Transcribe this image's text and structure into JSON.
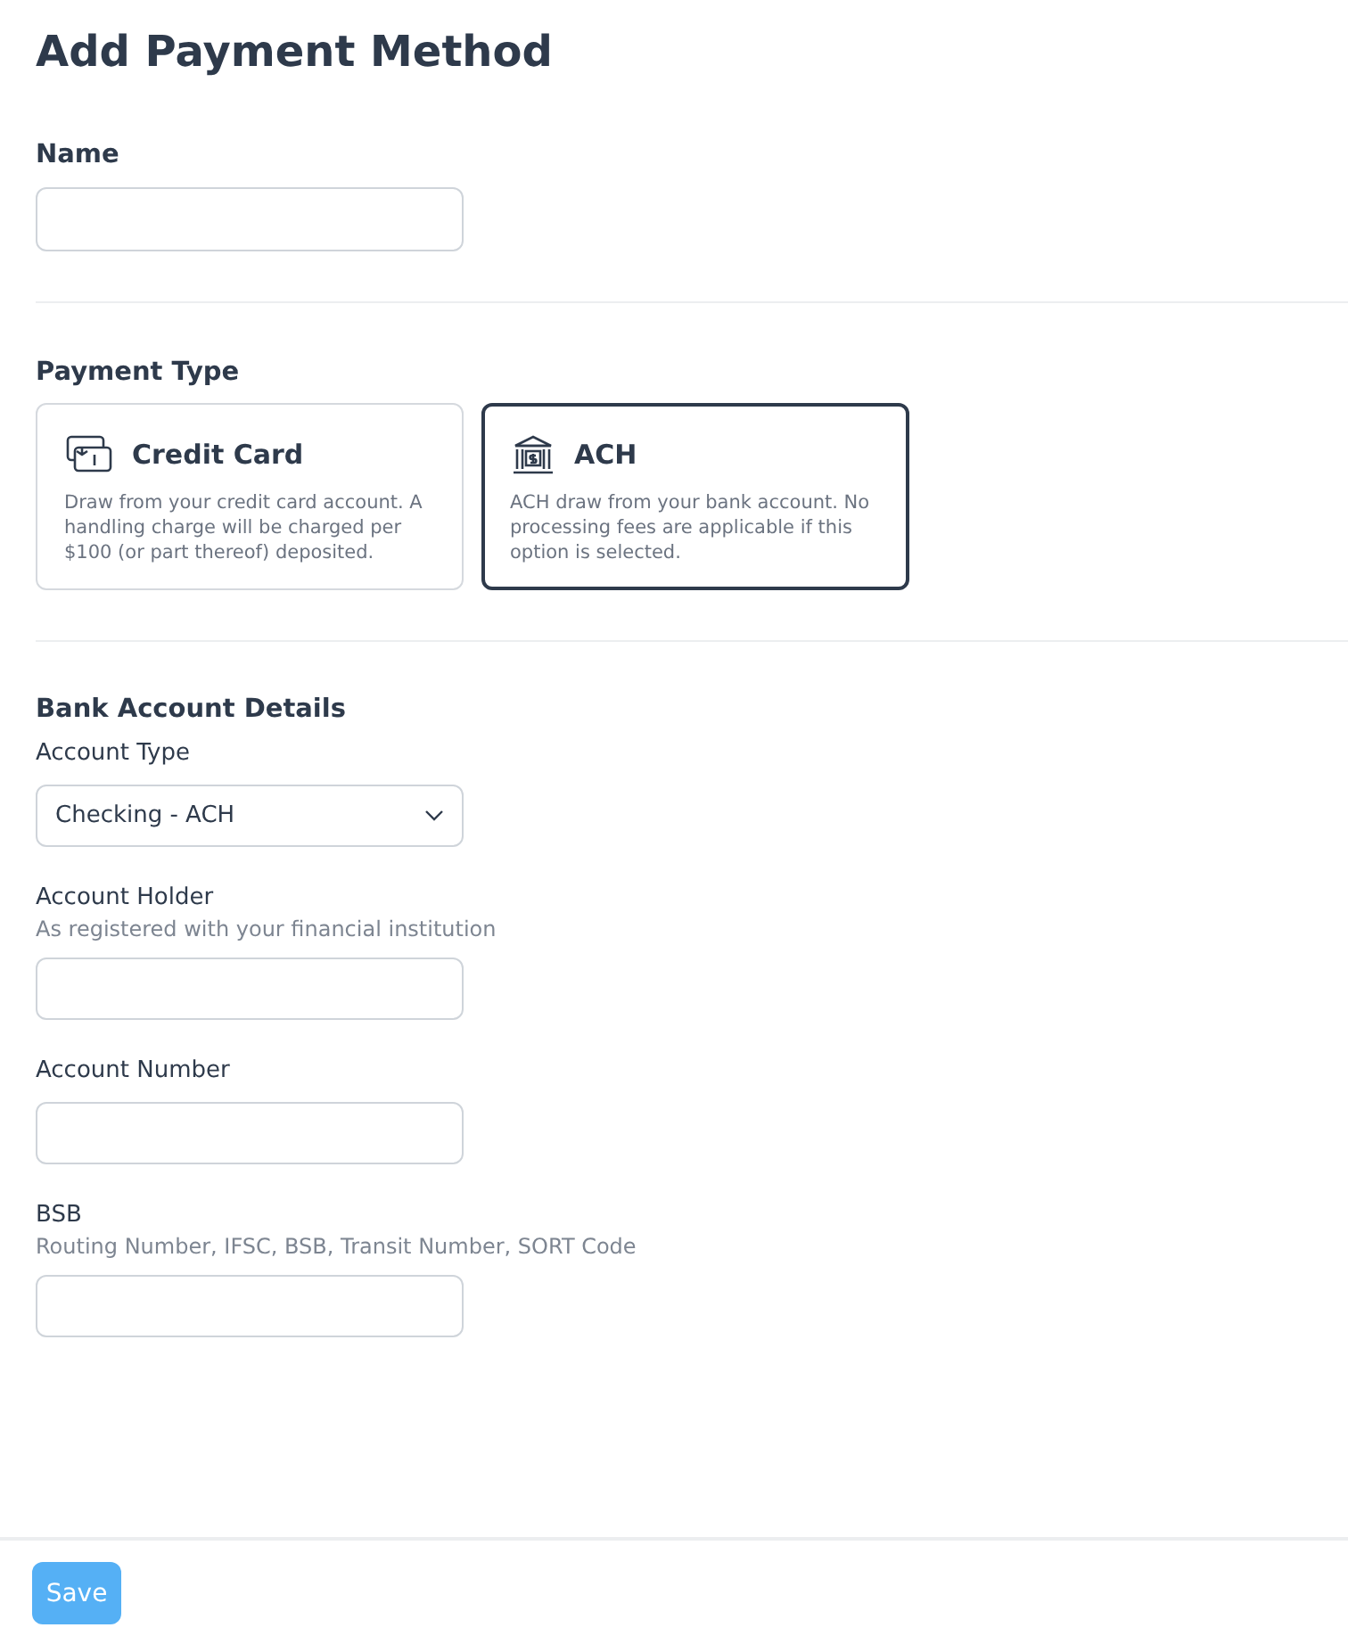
{
  "title": "Add Payment Method",
  "name_field": {
    "label": "Name"
  },
  "payment_type": {
    "heading": "Payment Type",
    "options": [
      {
        "kind": "card",
        "title": "Credit Card",
        "description": "Draw from your credit card account. A handling charge will be charged per $100 (or part thereof) deposited.",
        "selected": false
      },
      {
        "kind": "bank",
        "title": "ACH",
        "description": "ACH draw from your bank account. No processing fees are applicable if this option is selected.",
        "selected": true
      }
    ]
  },
  "bank_details": {
    "heading": "Bank Account Details",
    "fields": [
      {
        "kind": "select",
        "label": "Account Type",
        "value": "Checking - ACH"
      },
      {
        "kind": "text",
        "label": "Account Holder",
        "hint": "As registered with your financial institution"
      },
      {
        "kind": "text",
        "label": "Account Number"
      },
      {
        "kind": "text",
        "label": "BSB",
        "hint": "Routing Number, IFSC, BSB, Transit Number, SORT Code"
      }
    ]
  },
  "footer": {
    "save_button": "Save"
  }
}
